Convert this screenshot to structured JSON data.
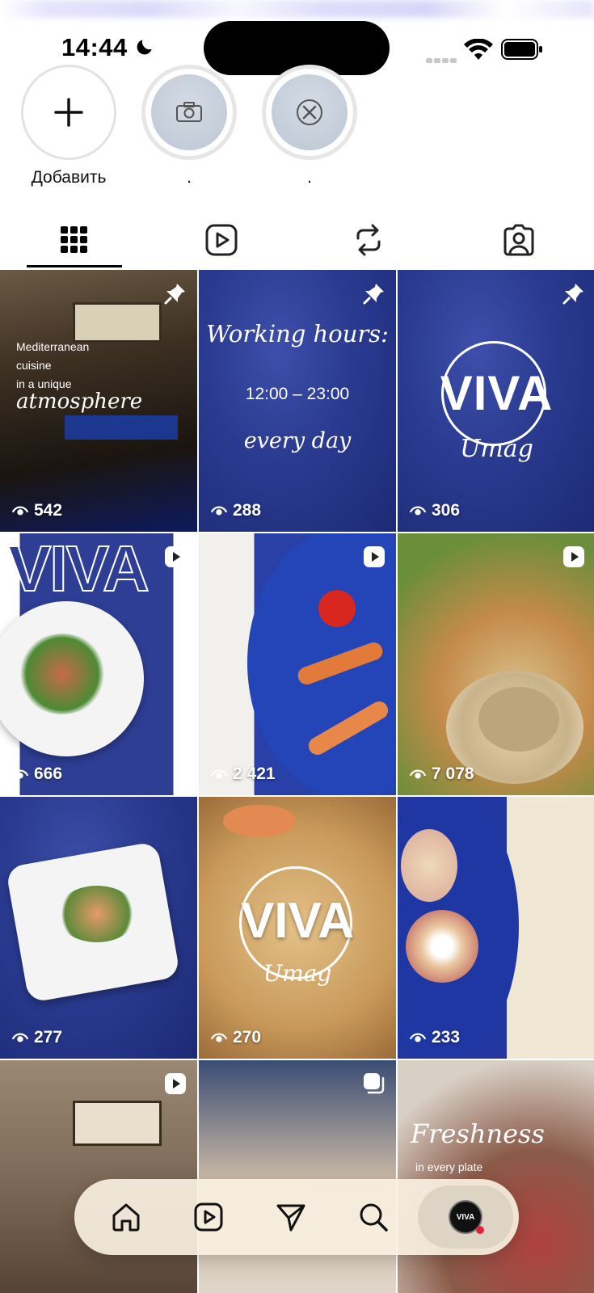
{
  "status": {
    "time": "14:44"
  },
  "highlights": [
    {
      "label": "Добавить",
      "icon": "plus-icon"
    },
    {
      "label": ".",
      "icon": "camera-icon"
    },
    {
      "label": ".",
      "icon": "cutlery-icon"
    }
  ],
  "tabs": [
    {
      "name": "posts-grid",
      "icon": "grid-icon",
      "active": true
    },
    {
      "name": "reels",
      "icon": "reels-icon",
      "active": false
    },
    {
      "name": "reposts",
      "icon": "repost-icon",
      "active": false
    },
    {
      "name": "tagged",
      "icon": "tagged-person-icon",
      "active": false
    }
  ],
  "posts": [
    {
      "views": "542",
      "badge": "pin-icon",
      "text1": "Mediterranean",
      "text2": "cuisine",
      "text3": "in a unique",
      "script": "atmosphere"
    },
    {
      "views": "288",
      "badge": "pin-icon",
      "script1": "Working hours:",
      "text": "12:00 – 23:00",
      "script2": "every day"
    },
    {
      "views": "306",
      "badge": "pin-icon",
      "logo": "VIVA",
      "logo_sub": "Umag"
    },
    {
      "views": "666",
      "badge": "reel-icon",
      "logo": "VIVA"
    },
    {
      "views": "2 421",
      "badge": "reel-icon"
    },
    {
      "views": "7 078",
      "badge": "reel-icon"
    },
    {
      "views": "277",
      "badge": ""
    },
    {
      "views": "270",
      "badge": "",
      "logo": "VIVA",
      "logo_sub": "Umag"
    },
    {
      "views": "233",
      "badge": ""
    },
    {
      "views": "",
      "badge": "reel-icon"
    },
    {
      "views": "",
      "badge": "carousel-icon"
    },
    {
      "views": "",
      "badge": "",
      "script": "Freshness",
      "text": "in every plate"
    }
  ],
  "bottom_nav": {
    "items": [
      "home-icon",
      "reels-icon",
      "direct-icon",
      "search-icon",
      "profile-avatar"
    ],
    "avatar_text": "VIVA"
  },
  "colors": {
    "accent_blue": "#2a3a8f",
    "notification_dot": "#e3233b"
  }
}
